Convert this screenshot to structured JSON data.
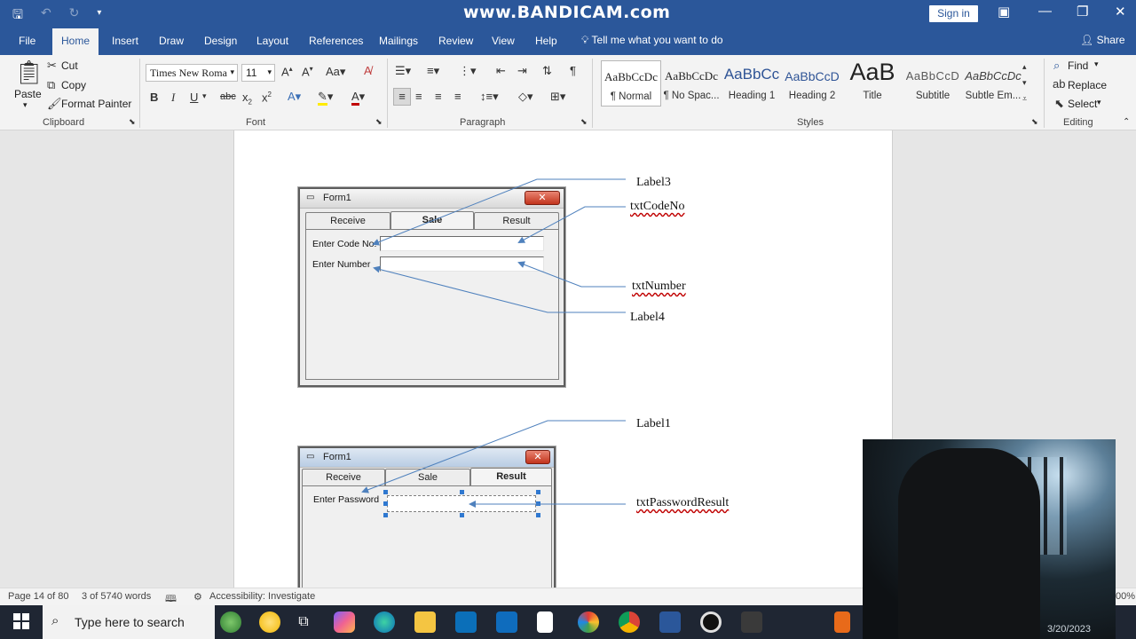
{
  "titlebar": {
    "watermark": "www.BANDICAM.com",
    "signin": "Sign in",
    "save_icon": "save-icon",
    "undo_icon": "undo-icon",
    "redo_icon": "redo-icon"
  },
  "tabs": [
    "File",
    "Home",
    "Insert",
    "Draw",
    "Design",
    "Layout",
    "References",
    "Mailings",
    "Review",
    "View",
    "Help"
  ],
  "tell_me": "Tell me what you want to do",
  "share": "Share",
  "clipboard": {
    "paste": "Paste",
    "cut": "Cut",
    "copy": "Copy",
    "format_painter": "Format Painter",
    "label": "Clipboard"
  },
  "font": {
    "name": "Times New Roma",
    "size": "11",
    "label": "Font"
  },
  "paragraph": {
    "label": "Paragraph"
  },
  "styles": {
    "label": "Styles",
    "items": [
      {
        "sample": "AaBbCcDc",
        "name": "¶ Normal"
      },
      {
        "sample": "AaBbCcDc",
        "name": "¶ No Spac..."
      },
      {
        "sample": "AaBbCc",
        "name": "Heading 1"
      },
      {
        "sample": "AaBbCcD",
        "name": "Heading 2"
      },
      {
        "sample": "AaB",
        "name": "Title"
      },
      {
        "sample": "AaBbCcD",
        "name": "Subtitle"
      },
      {
        "sample": "AaBbCcDc",
        "name": "Subtle Em..."
      }
    ]
  },
  "editing": {
    "find": "Find",
    "replace": "Replace",
    "select": "Select",
    "label": "Editing"
  },
  "document": {
    "form1": {
      "title": "Form1",
      "close": "✕",
      "tabs": [
        "Receive",
        "Sale",
        "Result"
      ],
      "active_tab": "Sale",
      "labels": [
        "Enter Code No:",
        "Enter Number"
      ]
    },
    "form2": {
      "title": "Form1",
      "close": "✕",
      "tabs": [
        "Receive",
        "Sale",
        "Result"
      ],
      "active_tab": "Result",
      "labels": [
        "Enter Password"
      ]
    },
    "annotations": {
      "label3": "Label3",
      "txtcodeno": "txtCodeNo",
      "txtnumber": "txtNumber",
      "label4": "Label4",
      "label1": "Label1",
      "txtpasswordresult": "txtPasswordResult"
    }
  },
  "statusbar": {
    "page": "Page 14 of 80",
    "words": "3 of 5740 words",
    "accessibility": "Accessibility: Investigate",
    "zoom": "00%"
  },
  "taskbar": {
    "search_placeholder": "Type here to search",
    "clock": "3/20/2023"
  }
}
